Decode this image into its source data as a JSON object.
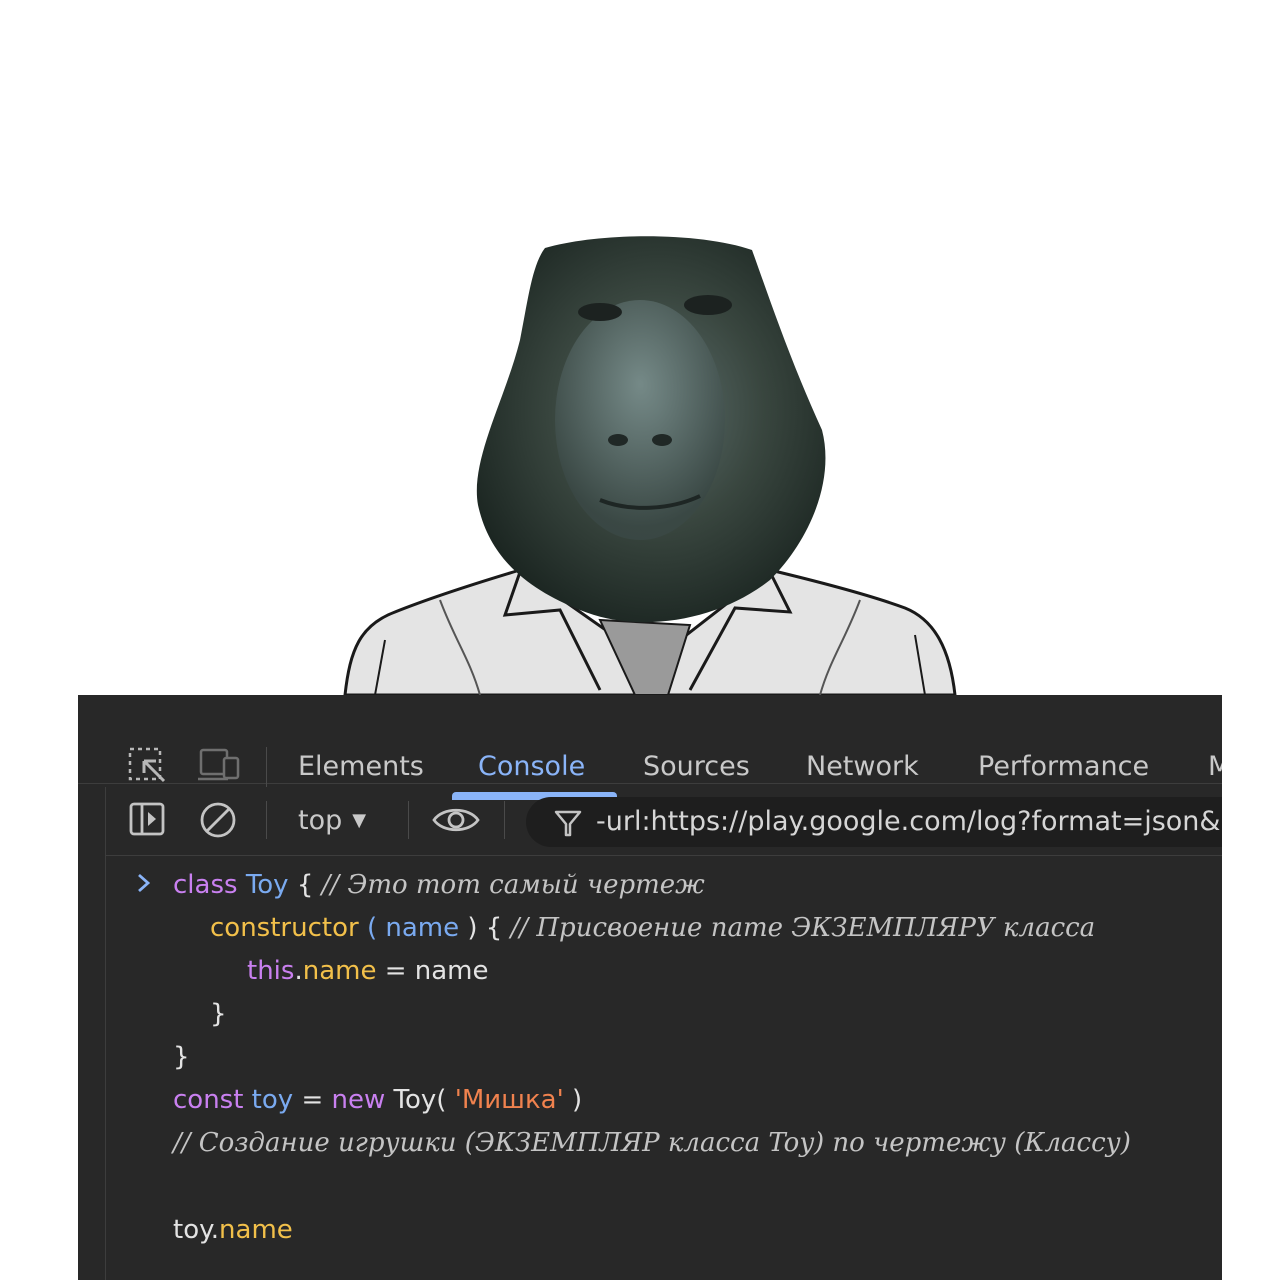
{
  "devtools": {
    "tabs": [
      "Elements",
      "Console",
      "Sources",
      "Network",
      "Performance",
      "M"
    ],
    "active_tab": "Console",
    "toolbar": {
      "context": "top",
      "filter_value": "-url:https://play.google.com/log?format=json&"
    },
    "code": {
      "l1_kw": "class",
      "l1_cls": "Toy",
      "l1_brace": " { ",
      "l1_cmt": "// Это тот самый чертеж",
      "l2_fn": "constructor",
      "l2_open": " ( ",
      "l2_param": "name",
      "l2_close": " ) { ",
      "l2_cmt": "// Присвоение name ЭКЗЕМПЛЯРУ класса",
      "l3_this": "this",
      "l3_dot": ".",
      "l3_prop": "name",
      "l3_rest": " = name",
      "l4": "}",
      "l5": "}",
      "l6_kw": "const",
      "l6_var": " toy",
      "l6_eq": " = ",
      "l6_new": "new",
      "l6_cls": " Toy( ",
      "l6_str": "'Мишка'",
      "l6_end": " )",
      "l7_cmt": "// Создание игрушки (ЭКЗЕМПЛЯР класса Toy) по чертежу (Классу)",
      "l8_obj": "toy.",
      "l8_prop": "name"
    }
  }
}
